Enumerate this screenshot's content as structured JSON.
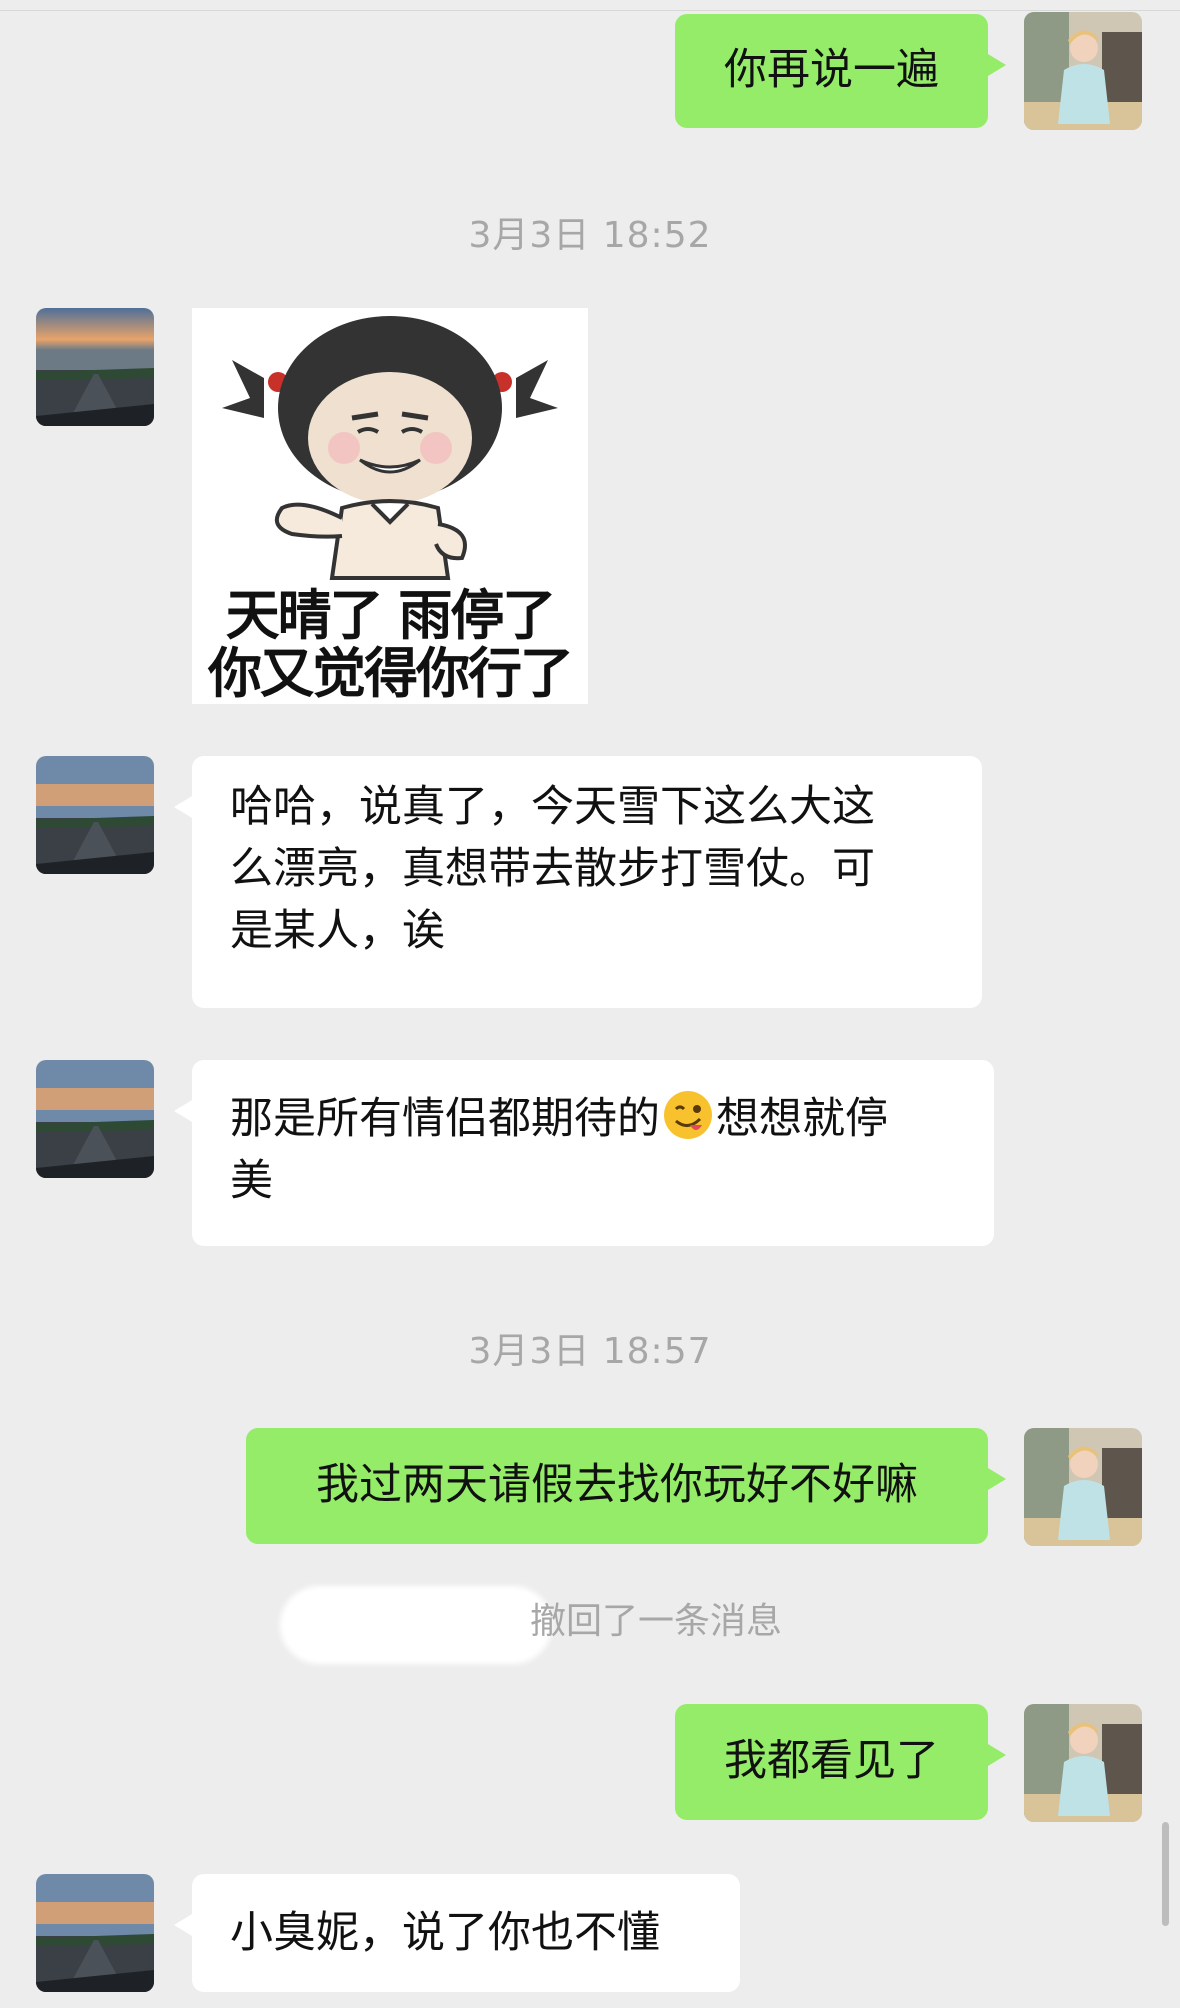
{
  "messages": [
    {
      "sender": "me",
      "text": "你再说一遍"
    },
    {
      "timestamp": "3月3日 18:52"
    },
    {
      "sender": "other",
      "type": "sticker",
      "caption_line1": "天晴了 雨停了",
      "caption_line2": "你又觉得你行了"
    },
    {
      "sender": "other",
      "lines": [
        "哈哈，说真了，今天雪下这么大这",
        "么漂亮，真想带去散步打雪仗。可",
        "是某人，诶"
      ]
    },
    {
      "sender": "other",
      "line1_before_emoji": "那是所有情侣都期待的",
      "emoji": "winking-face-tongue",
      "line1_after_emoji": "想想就停",
      "line2": "美"
    },
    {
      "timestamp": "3月3日 18:57"
    },
    {
      "sender": "me",
      "text": "我过两天请假去找你玩好不好嘛"
    },
    {
      "system": "撤回了一条消息"
    },
    {
      "sender": "me",
      "text": "我都看见了"
    },
    {
      "sender": "other",
      "text": "小臭妮，说了你也不懂"
    }
  ],
  "colors": {
    "background": "#ededed",
    "my_bubble": "#95ec69",
    "other_bubble": "#ffffff",
    "timestamp_text": "#a7a7a7"
  }
}
